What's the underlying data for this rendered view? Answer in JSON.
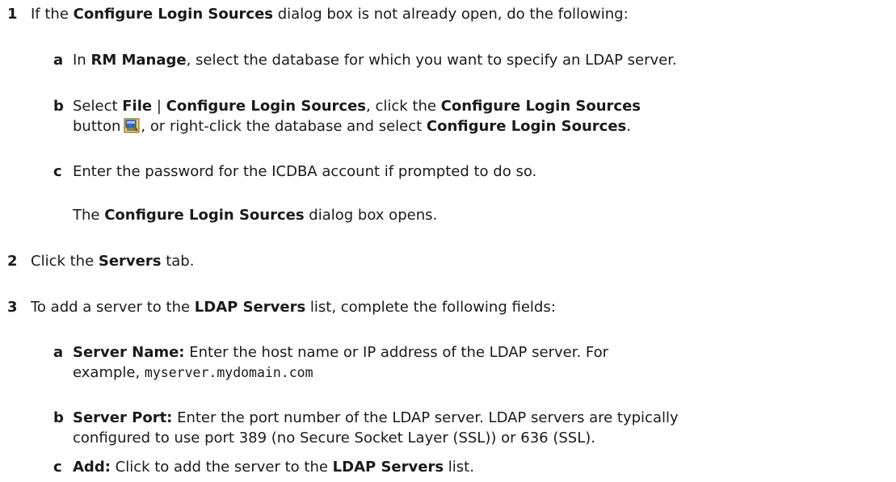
{
  "steps": [
    {
      "num": "1",
      "text": {
        "a": "If the ",
        "b": "Configure Login Sources",
        "c": " dialog box is not already open, do the following:"
      },
      "substeps": [
        {
          "letter": "a",
          "text": {
            "a": "In ",
            "b": "RM Manage",
            "c": ", select the database for which you want to specify an LDAP server."
          }
        },
        {
          "letter": "b",
          "line1": {
            "a": "Select ",
            "b": "File",
            "c": " | ",
            "d": "Configure Login Sources",
            "e": ", click the ",
            "f": "Configure Login Sources"
          },
          "line2": {
            "a": "button",
            "icon": "configure-login-sources-icon",
            "b": ", or right-click the database and select ",
            "c": "Configure Login Sources",
            "d": "."
          }
        },
        {
          "letter": "c",
          "text": "Enter the password for the ICDBA account if prompted to do so."
        }
      ],
      "note": {
        "a": "The ",
        "b": "Configure Login Sources",
        "c": " dialog box opens."
      }
    },
    {
      "num": "2",
      "text": {
        "a": "Click the ",
        "b": "Servers",
        "c": " tab."
      }
    },
    {
      "num": "3",
      "text": {
        "a": "To add a server to the ",
        "b": "LDAP Servers",
        "c": " list, complete the following fields:"
      },
      "substeps": [
        {
          "letter": "a",
          "line1": {
            "a": "Server Name:",
            "b": " Enter the host name or IP address of the LDAP server. For"
          },
          "line2": {
            "a": "example, ",
            "b": "myserver.mydomain.com"
          }
        },
        {
          "letter": "b",
          "line1": {
            "a": "Server Port:",
            "b": " Enter the port number of the LDAP server. LDAP servers are typically"
          },
          "line2": "configured to use port 389 (no Secure Socket Layer (SSL)) or 636 (SSL)."
        },
        {
          "letter": "c",
          "text": {
            "a": "Add:",
            "b": " Click to add the server to the ",
            "c": "LDAP Servers",
            "d": " list."
          }
        }
      ]
    }
  ]
}
